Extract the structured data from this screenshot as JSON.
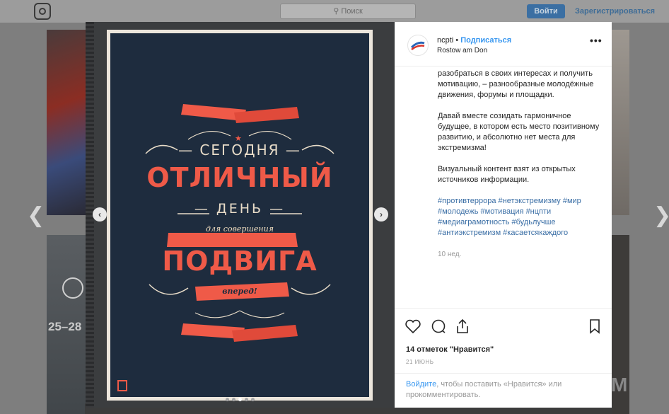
{
  "topbar": {
    "search_placeholder": "Поиск",
    "login_label": "Войти",
    "register_label": "Зарегистрироваться"
  },
  "background": {
    "tile_left_text_1": "25–28",
    "tile_right_text": "M"
  },
  "post": {
    "username": "ncpti",
    "separator": " • ",
    "follow_label": "Подписаться",
    "location": "Rostow am Don",
    "more_label": "•••",
    "image": {
      "poster_lines": {
        "line1": "— СЕГОДНЯ —",
        "line2": "ОТЛИЧНЫЙ",
        "line3": "— ДЕНЬ —",
        "line4": "для совершения",
        "line5": "ПОДВИГА",
        "line6": "вперед!"
      },
      "carousel_dots": 5,
      "active_dot": 2
    },
    "caption": {
      "paragraph1": "разобраться в своих интересах и получить мотивацию, – разнообразные молодёжные движения, форумы и площадки.",
      "paragraph2": "Давай вместе созидать гармоничное будущее, в котором есть место позитивному развитию, и абсолютно нет места для экстремизма!",
      "paragraph3": "Визуальный контент взят из открытых источников информации.",
      "hashtags": "#противтеррора #нетэкстремизму #мир #молодежь #мотивация #нцпти #медиаграмотность #будьлучше #антиэкстремизм #касаетсякаждого",
      "age": "10 нед."
    },
    "likes": "14 отметок \"Нравится\"",
    "date": "21 ИЮНЬ",
    "comment_login_link": "Войдите",
    "comment_rest": ", чтобы поставить «Нравится» или прокомментировать."
  },
  "icons": {
    "like": "heart-icon",
    "comment": "comment-icon",
    "share": "share-icon",
    "save": "bookmark-icon",
    "prev": "chevron-left-icon",
    "next": "chevron-right-icon"
  },
  "colors": {
    "poster_bg": "#1e2c3e",
    "poster_red": "#ef5a48",
    "link_blue": "#3897f0"
  }
}
